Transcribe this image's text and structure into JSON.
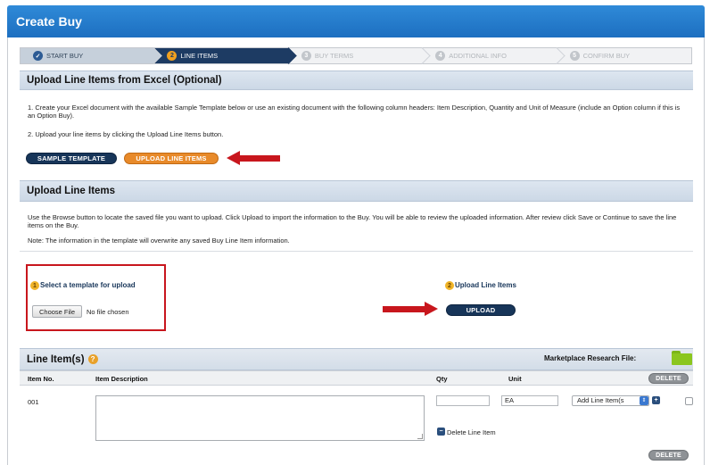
{
  "window": {
    "title": "Create Buy"
  },
  "steps": [
    {
      "number": "✓",
      "label": "START BUY",
      "state": "done"
    },
    {
      "number": "2",
      "label": "LINE ITEMS",
      "state": "active"
    },
    {
      "number": "3",
      "label": "BUY TERMS",
      "state": "pending"
    },
    {
      "number": "4",
      "label": "ADDITIONAL INFO",
      "state": "pending"
    },
    {
      "number": "5",
      "label": "CONFIRM BUY",
      "state": "pending"
    }
  ],
  "upload_excel": {
    "heading": "Upload Line Items from Excel (Optional)",
    "instruction_1": "1. Create your Excel document with the available Sample Template below or use an existing document with the following column headers: Item Description, Quantity and Unit of Measure (include an Option column if this is an Option Buy).",
    "instruction_2": "2. Upload your line items by clicking the Upload Line Items button.",
    "sample_template_button": "SAMPLE TEMPLATE",
    "upload_line_items_button": "UPLOAD LINE ITEMS"
  },
  "upload_panel": {
    "heading": "Upload Line Items",
    "description": "Use the Browse button to locate the saved file you want to upload. Click Upload to import the information to the Buy. You will be able to review the uploaded information. After review click Save or Continue to save the line items on the Buy.",
    "note": "Note: The information in the template will overwrite any saved Buy Line Item information.",
    "step1_number": "1",
    "step1_label": "Select a template for upload",
    "choose_file_button": "Choose File",
    "no_file_text": "No file chosen",
    "step2_number": "2",
    "step2_label": "Upload Line Items",
    "upload_button": "UPLOAD"
  },
  "line_items": {
    "heading": "Line Item(s)",
    "help_icon": "?",
    "marketplace_label": "Marketplace Research File:",
    "columns": {
      "item_no": "Item No.",
      "description": "Item Description",
      "qty": "Qty",
      "unit": "Unit"
    },
    "delete_button": "DELETE",
    "rows": [
      {
        "item_no": "001",
        "description": "",
        "qty": "",
        "unit": "EA",
        "add_option": "Add Line Item(s",
        "delete_line_label": "Delete Line Item"
      }
    ]
  },
  "colors": {
    "accent_blue": "#1d6fc0",
    "navy": "#173559",
    "orange": "#e88a2a",
    "red_annotation": "#c8161d"
  },
  "icons": [
    "check-icon",
    "help-icon",
    "folder-icon",
    "plus-icon",
    "minus-icon",
    "spinner-icon",
    "red-arrow-icon"
  ]
}
